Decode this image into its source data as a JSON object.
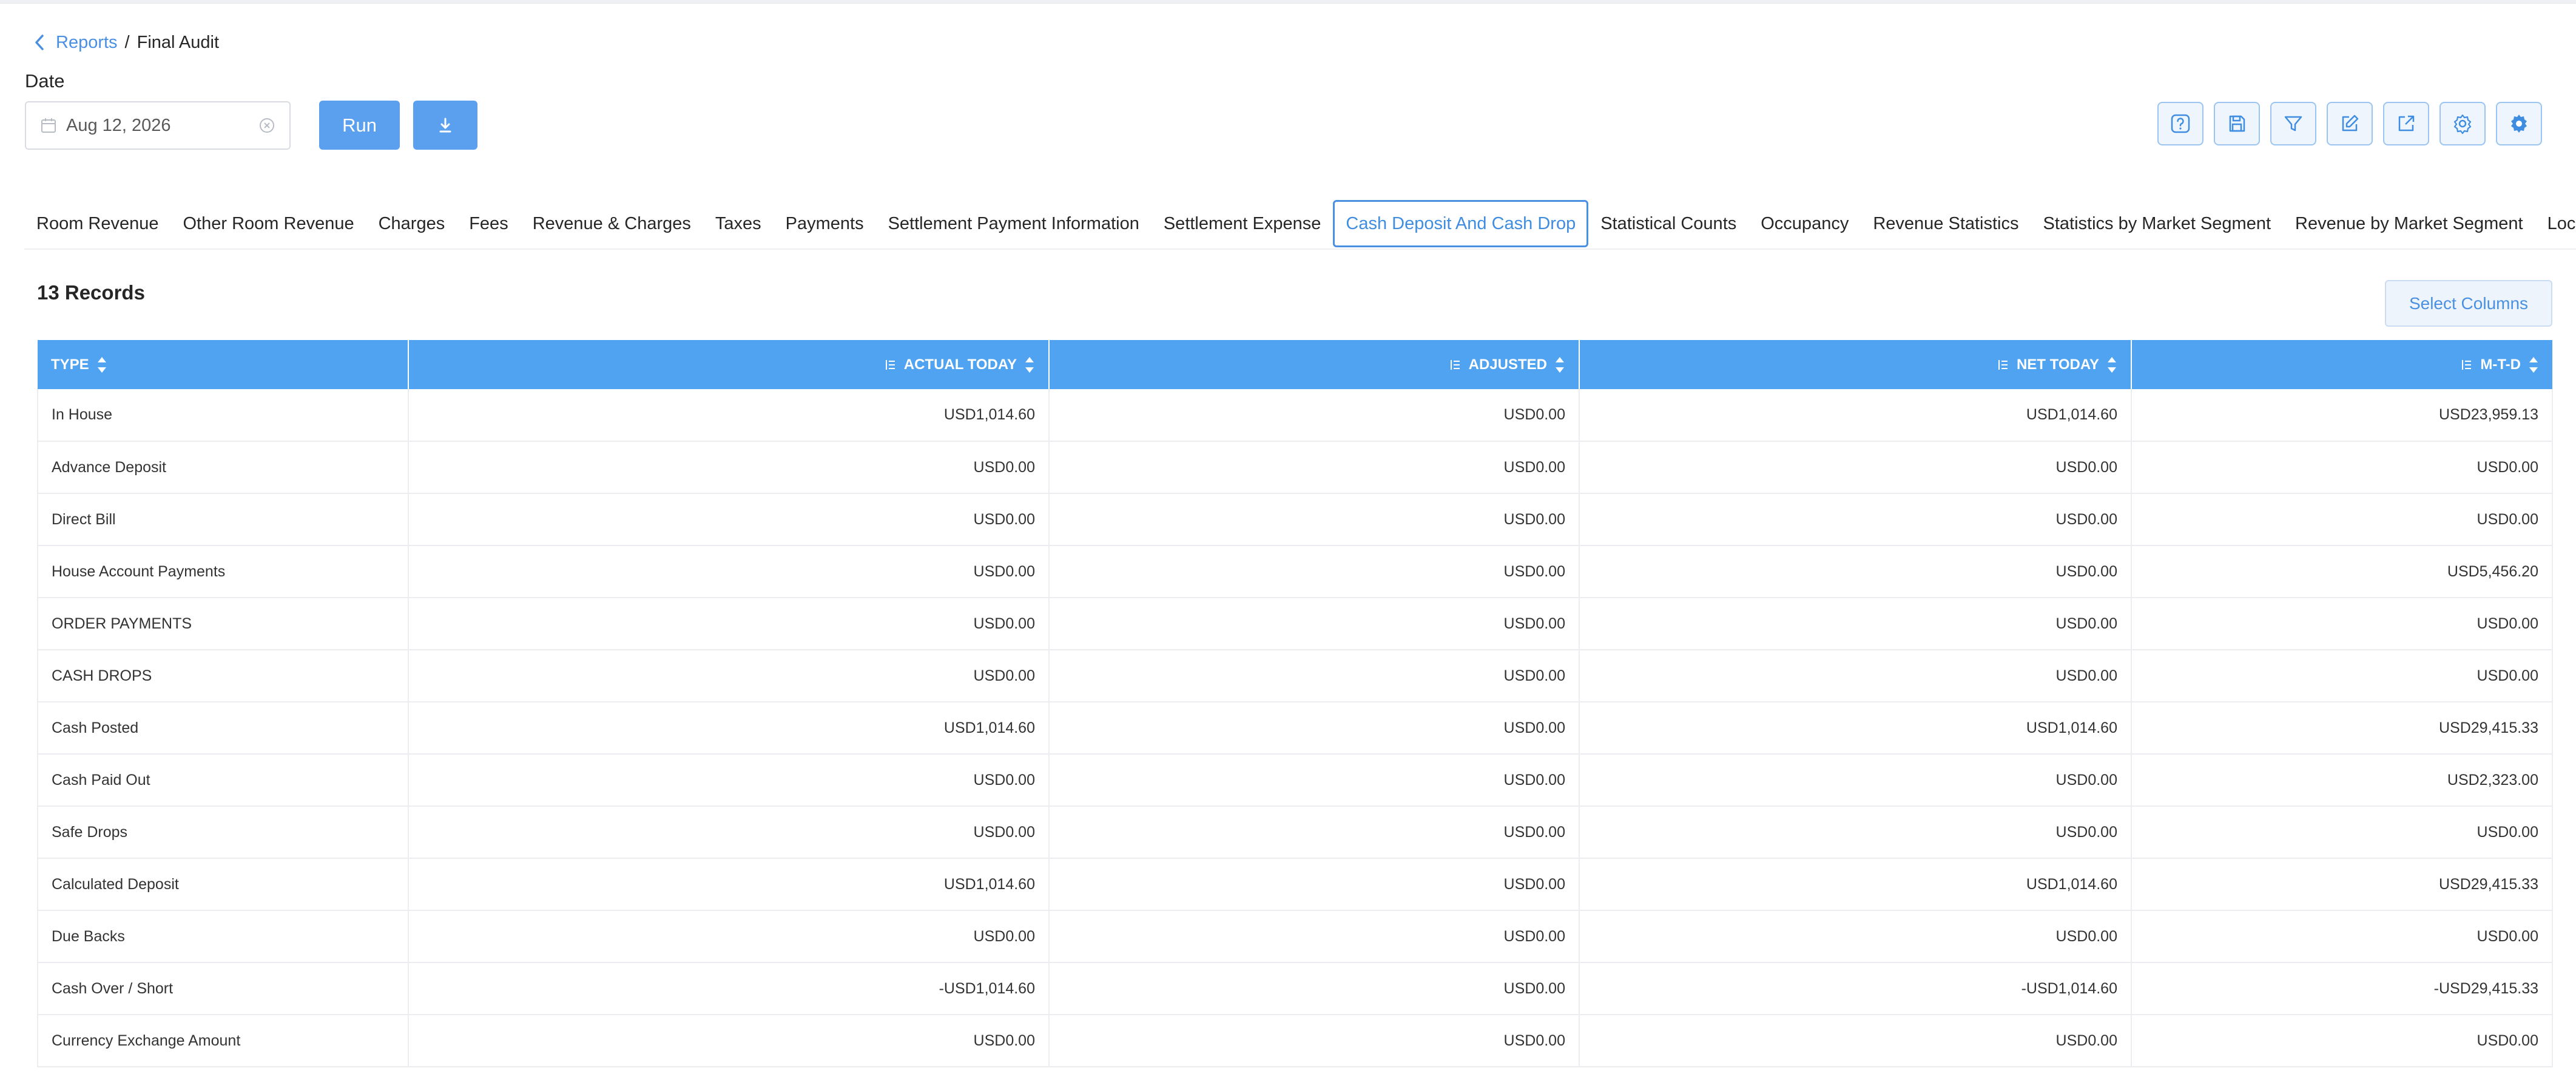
{
  "breadcrumb": {
    "parent": "Reports",
    "separator": "/",
    "current": "Final Audit"
  },
  "filters": {
    "date_label": "Date",
    "date_value": "Aug 12, 2026"
  },
  "actions": {
    "run_label": "Run"
  },
  "toolbar_icons": [
    "help-icon",
    "save-icon",
    "filter-icon",
    "edit-icon",
    "export-icon",
    "settings-icon",
    "gear-badge-icon"
  ],
  "tabs": [
    "Room Revenue",
    "Other Room Revenue",
    "Charges",
    "Fees",
    "Revenue & Charges",
    "Taxes",
    "Payments",
    "Settlement Payment Information",
    "Settlement Expense",
    "Cash Deposit And Cash Drop",
    "Statistical Counts",
    "Occupancy",
    "Revenue Statistics",
    "Statistics by Market Segment",
    "Revenue by Market Segment",
    "Local M"
  ],
  "active_tab": "Cash Deposit And Cash Drop",
  "records_label": "13 Records",
  "select_columns_label": "Select Columns",
  "colors": {
    "accent": "#4fa3f0",
    "button": "#5aa0ef",
    "link": "#4a90e2"
  },
  "table": {
    "columns": [
      "TYPE",
      "ACTUAL TODAY",
      "ADJUSTED",
      "NET TODAY",
      "M-T-D"
    ],
    "rows": [
      [
        "In House",
        "USD1,014.60",
        "USD0.00",
        "USD1,014.60",
        "USD23,959.13"
      ],
      [
        "Advance Deposit",
        "USD0.00",
        "USD0.00",
        "USD0.00",
        "USD0.00"
      ],
      [
        "Direct Bill",
        "USD0.00",
        "USD0.00",
        "USD0.00",
        "USD0.00"
      ],
      [
        "House Account Payments",
        "USD0.00",
        "USD0.00",
        "USD0.00",
        "USD5,456.20"
      ],
      [
        "ORDER PAYMENTS",
        "USD0.00",
        "USD0.00",
        "USD0.00",
        "USD0.00"
      ],
      [
        "CASH DROPS",
        "USD0.00",
        "USD0.00",
        "USD0.00",
        "USD0.00"
      ],
      [
        "Cash Posted",
        "USD1,014.60",
        "USD0.00",
        "USD1,014.60",
        "USD29,415.33"
      ],
      [
        "Cash Paid Out",
        "USD0.00",
        "USD0.00",
        "USD0.00",
        "USD2,323.00"
      ],
      [
        "Safe Drops",
        "USD0.00",
        "USD0.00",
        "USD0.00",
        "USD0.00"
      ],
      [
        "Calculated Deposit",
        "USD1,014.60",
        "USD0.00",
        "USD1,014.60",
        "USD29,415.33"
      ],
      [
        "Due Backs",
        "USD0.00",
        "USD0.00",
        "USD0.00",
        "USD0.00"
      ],
      [
        "Cash Over / Short",
        "-USD1,014.60",
        "USD0.00",
        "-USD1,014.60",
        "-USD29,415.33"
      ],
      [
        "Currency Exchange Amount",
        "USD0.00",
        "USD0.00",
        "USD0.00",
        "USD0.00"
      ]
    ]
  }
}
